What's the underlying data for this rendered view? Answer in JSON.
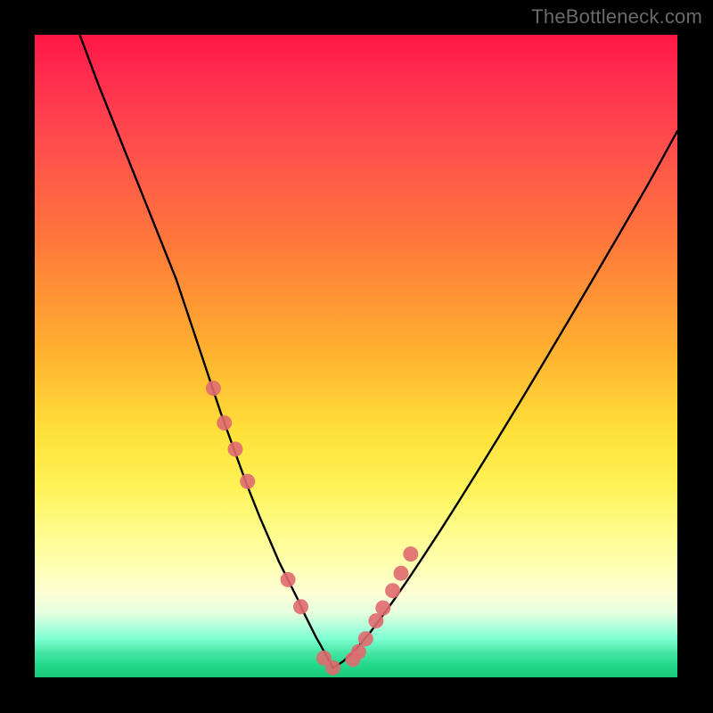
{
  "watermark": "TheBottleneck.com",
  "chart_data": {
    "type": "line",
    "title": "",
    "xlabel": "",
    "ylabel": "",
    "xlim": [
      0,
      100
    ],
    "ylim": [
      0,
      100
    ],
    "series": [
      {
        "name": "curve-left",
        "x": [
          7,
          10,
          14,
          18,
          22,
          25,
          27,
          29,
          31,
          33,
          35,
          36.5,
          38,
          39.5,
          41,
          42,
          43,
          43.8,
          44.6,
          45.3,
          45.9,
          46.4
        ],
        "values": [
          100,
          92,
          82,
          72,
          62,
          53,
          47,
          41,
          35.5,
          30,
          25,
          21.5,
          18,
          15,
          12,
          9.8,
          7.8,
          6.2,
          4.8,
          3.5,
          2.4,
          1.5
        ]
      },
      {
        "name": "curve-right",
        "x": [
          46.4,
          47,
          48,
          49.2,
          50.6,
          52.2,
          54,
          56,
          58.2,
          60.6,
          63.2,
          66,
          69,
          72.2,
          75.6,
          79.2,
          83,
          87,
          91.2,
          95.6,
          100
        ],
        "values": [
          1.5,
          1.8,
          2.5,
          3.6,
          5.1,
          7,
          9.4,
          12.2,
          15.4,
          19,
          23,
          27.4,
          32.2,
          37.4,
          43,
          49,
          55.4,
          62.2,
          69.4,
          77,
          85
        ]
      }
    ],
    "scatter": {
      "name": "highlight-points",
      "x": [
        27.8,
        29.5,
        31.2,
        33.1,
        39.4,
        41.4,
        45.0,
        46.4,
        49.5,
        50.4,
        51.5,
        53.1,
        54.2,
        55.7,
        57.0,
        58.5
      ],
      "values": [
        45.0,
        39.6,
        35.5,
        30.5,
        15.2,
        11.0,
        3.0,
        1.5,
        2.8,
        4.0,
        6.0,
        8.8,
        10.8,
        13.5,
        16.2,
        19.2
      ]
    },
    "gradient_stops": [
      {
        "pos": 0,
        "color": "#ff1744"
      },
      {
        "pos": 17,
        "color": "#ff4d4d"
      },
      {
        "pos": 33,
        "color": "#ff7a3a"
      },
      {
        "pos": 49,
        "color": "#ffb030"
      },
      {
        "pos": 62,
        "color": "#ffe13a"
      },
      {
        "pos": 77,
        "color": "#fffc8a"
      },
      {
        "pos": 90,
        "color": "#e6ffdf"
      },
      {
        "pos": 100,
        "color": "#17c877"
      }
    ]
  }
}
